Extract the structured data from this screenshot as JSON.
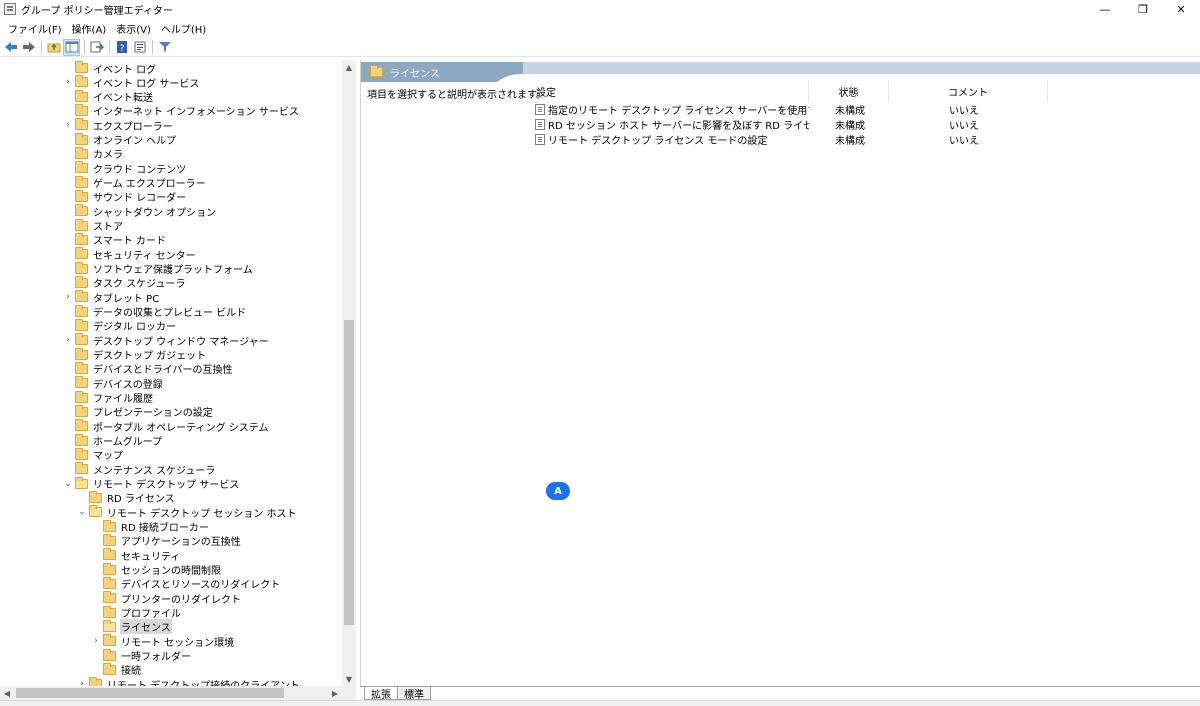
{
  "window": {
    "title": "グループ ポリシー管理エディター",
    "minimize": "—",
    "restore": "❐",
    "close": "✕"
  },
  "menu": [
    "ファイル(F)",
    "操作(A)",
    "表示(V)",
    "ヘルプ(H)"
  ],
  "toolbar": {
    "icons": [
      "back-icon",
      "forward-icon",
      "up-folder-icon",
      "show-hide-tree-icon",
      "export-list-icon",
      "help-icon",
      "properties-icon",
      "filter-icon"
    ]
  },
  "tree": {
    "items": [
      {
        "label": "イベント ログ",
        "indent": 0,
        "chevron": "",
        "open": false,
        "selected": false
      },
      {
        "label": "イベント ログ サービス",
        "indent": 0,
        "chevron": ">",
        "open": false,
        "selected": false
      },
      {
        "label": "イベント転送",
        "indent": 0,
        "chevron": "",
        "open": false,
        "selected": false
      },
      {
        "label": "インターネット インフォメーション サービス",
        "indent": 0,
        "chevron": "",
        "open": false,
        "selected": false
      },
      {
        "label": "エクスプローラー",
        "indent": 0,
        "chevron": ">",
        "open": false,
        "selected": false
      },
      {
        "label": "オンライン ヘルプ",
        "indent": 0,
        "chevron": "",
        "open": false,
        "selected": false
      },
      {
        "label": "カメラ",
        "indent": 0,
        "chevron": "",
        "open": false,
        "selected": false
      },
      {
        "label": "クラウド コンテンツ",
        "indent": 0,
        "chevron": "",
        "open": false,
        "selected": false
      },
      {
        "label": "ゲーム エクスプローラー",
        "indent": 0,
        "chevron": "",
        "open": false,
        "selected": false
      },
      {
        "label": "サウンド レコーダー",
        "indent": 0,
        "chevron": "",
        "open": false,
        "selected": false
      },
      {
        "label": "シャットダウン オプション",
        "indent": 0,
        "chevron": "",
        "open": false,
        "selected": false
      },
      {
        "label": "ストア",
        "indent": 0,
        "chevron": "",
        "open": false,
        "selected": false
      },
      {
        "label": "スマート カード",
        "indent": 0,
        "chevron": "",
        "open": false,
        "selected": false
      },
      {
        "label": "セキュリティ センター",
        "indent": 0,
        "chevron": "",
        "open": false,
        "selected": false
      },
      {
        "label": "ソフトウェア保護プラットフォーム",
        "indent": 0,
        "chevron": "",
        "open": false,
        "selected": false
      },
      {
        "label": "タスク スケジューラ",
        "indent": 0,
        "chevron": "",
        "open": false,
        "selected": false
      },
      {
        "label": "タブレット PC",
        "indent": 0,
        "chevron": ">",
        "open": false,
        "selected": false
      },
      {
        "label": "データの収集とプレビュー ビルド",
        "indent": 0,
        "chevron": "",
        "open": false,
        "selected": false
      },
      {
        "label": "デジタル ロッカー",
        "indent": 0,
        "chevron": "",
        "open": false,
        "selected": false
      },
      {
        "label": "デスクトップ ウィンドウ マネージャー",
        "indent": 0,
        "chevron": ">",
        "open": false,
        "selected": false
      },
      {
        "label": "デスクトップ ガジェット",
        "indent": 0,
        "chevron": "",
        "open": false,
        "selected": false
      },
      {
        "label": "デバイスとドライバーの互換性",
        "indent": 0,
        "chevron": "",
        "open": false,
        "selected": false
      },
      {
        "label": "デバイスの登録",
        "indent": 0,
        "chevron": "",
        "open": false,
        "selected": false
      },
      {
        "label": "ファイル履歴",
        "indent": 0,
        "chevron": "",
        "open": false,
        "selected": false
      },
      {
        "label": "プレゼンテーションの設定",
        "indent": 0,
        "chevron": "",
        "open": false,
        "selected": false
      },
      {
        "label": "ポータブル オペレーティング システム",
        "indent": 0,
        "chevron": "",
        "open": false,
        "selected": false
      },
      {
        "label": "ホームグループ",
        "indent": 0,
        "chevron": "",
        "open": false,
        "selected": false
      },
      {
        "label": "マップ",
        "indent": 0,
        "chevron": "",
        "open": false,
        "selected": false
      },
      {
        "label": "メンテナンス スケジューラ",
        "indent": 0,
        "chevron": "",
        "open": false,
        "selected": false
      },
      {
        "label": "リモート デスクトップ サービス",
        "indent": 0,
        "chevron": "v",
        "open": true,
        "selected": false
      },
      {
        "label": "RD ライセンス",
        "indent": 1,
        "chevron": "",
        "open": false,
        "selected": false
      },
      {
        "label": "リモート デスクトップ セッション ホスト",
        "indent": 1,
        "chevron": "v",
        "open": true,
        "selected": false
      },
      {
        "label": "RD 接続ブローカー",
        "indent": 2,
        "chevron": "",
        "open": false,
        "selected": false
      },
      {
        "label": "アプリケーションの互換性",
        "indent": 2,
        "chevron": "",
        "open": false,
        "selected": false
      },
      {
        "label": "セキュリティ",
        "indent": 2,
        "chevron": "",
        "open": false,
        "selected": false
      },
      {
        "label": "セッションの時間制限",
        "indent": 2,
        "chevron": "",
        "open": false,
        "selected": false
      },
      {
        "label": "デバイスとリソースのリダイレクト",
        "indent": 2,
        "chevron": "",
        "open": false,
        "selected": false
      },
      {
        "label": "プリンターのリダイレクト",
        "indent": 2,
        "chevron": "",
        "open": false,
        "selected": false
      },
      {
        "label": "プロファイル",
        "indent": 2,
        "chevron": "",
        "open": false,
        "selected": false
      },
      {
        "label": "ライセンス",
        "indent": 2,
        "chevron": "",
        "open": true,
        "selected": true
      },
      {
        "label": "リモート セッション環境",
        "indent": 2,
        "chevron": ">",
        "open": false,
        "selected": false
      },
      {
        "label": "一時フォルダー",
        "indent": 2,
        "chevron": "",
        "open": false,
        "selected": false
      },
      {
        "label": "接続",
        "indent": 2,
        "chevron": "",
        "open": false,
        "selected": false
      },
      {
        "label": "リモート デスクトップ接続のクライアント",
        "indent": 1,
        "chevron": ">",
        "open": false,
        "selected": false
      }
    ]
  },
  "scroll": {
    "up": "▲",
    "down": "▼",
    "left": "◀",
    "right": "▶"
  },
  "content": {
    "header_title": "ライセンス",
    "description": "項目を選択すると説明が表示されます。",
    "columns": {
      "setting": "設定",
      "state": "状態",
      "comment": "コメント"
    },
    "rows": [
      {
        "setting": "指定のリモート デスクトップ ライセンス サーバーを使用する",
        "state": "未構成",
        "comment": "いいえ"
      },
      {
        "setting": "RD セッション ホスト サーバーに影響を及ぼす RD ライセンスの問題に...",
        "state": "未構成",
        "comment": "いいえ"
      },
      {
        "setting": "リモート デスクトップ ライセンス モードの設定",
        "state": "未構成",
        "comment": "いいえ"
      }
    ]
  },
  "bottom_tabs": [
    "拡張",
    "標準"
  ],
  "badge": "A",
  "colors": {
    "header_band": "#c6d5e4",
    "header_tab": "#8fa8c2",
    "folder": "#f6d27a",
    "badge": "#1a73e8"
  }
}
